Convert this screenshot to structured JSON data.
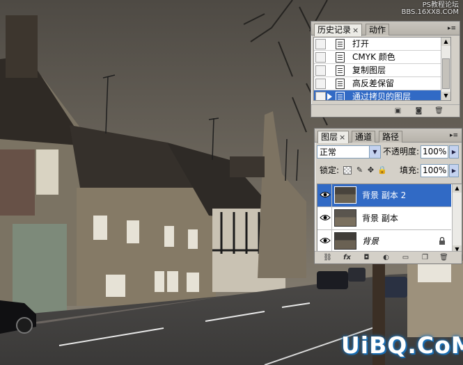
{
  "watermark": {
    "top_line1": "PS教程论坛",
    "top_line2": "BBS.16XX8.COM",
    "bottom": "UiBQ.CoM"
  },
  "history_panel": {
    "tabs": [
      {
        "label": "历史记录",
        "close": "×",
        "active": true
      },
      {
        "label": "动作",
        "active": false
      }
    ],
    "menu_icon": "panel-menu-icon",
    "items": [
      {
        "label": "打开",
        "selected": false
      },
      {
        "label": "CMYK 颜色",
        "selected": false
      },
      {
        "label": "复制图层",
        "selected": false
      },
      {
        "label": "高反差保留",
        "selected": false
      },
      {
        "label": "通过拷贝的图层",
        "selected": true
      }
    ],
    "bottom_icons": [
      "new-document-from-state-icon",
      "create-snapshot-icon",
      "delete-state-icon"
    ]
  },
  "layers_panel": {
    "tabs": [
      {
        "label": "图层",
        "close": "×",
        "active": true
      },
      {
        "label": "通道",
        "active": false
      },
      {
        "label": "路径",
        "active": false
      }
    ],
    "blend_mode": "正常",
    "opacity_label": "不透明度:",
    "opacity_value": "100%",
    "lock_label": "锁定:",
    "fill_label": "填充:",
    "fill_value": "100%",
    "layers": [
      {
        "name": "背景 副本 2",
        "selected": true,
        "italic": false,
        "locked": false
      },
      {
        "name": "背景 副本",
        "selected": false,
        "italic": false,
        "locked": false
      },
      {
        "name": "背景",
        "selected": false,
        "italic": true,
        "locked": true
      }
    ],
    "bottom_icons": [
      "link-layers-icon",
      "layer-style-fx-icon",
      "layer-mask-icon",
      "adjustment-layer-icon",
      "new-group-icon",
      "new-layer-icon",
      "delete-layer-icon"
    ],
    "fx_label": "fx"
  },
  "colors": {
    "selection": "#316ac5",
    "panel_bg": "#d4d0c8"
  }
}
